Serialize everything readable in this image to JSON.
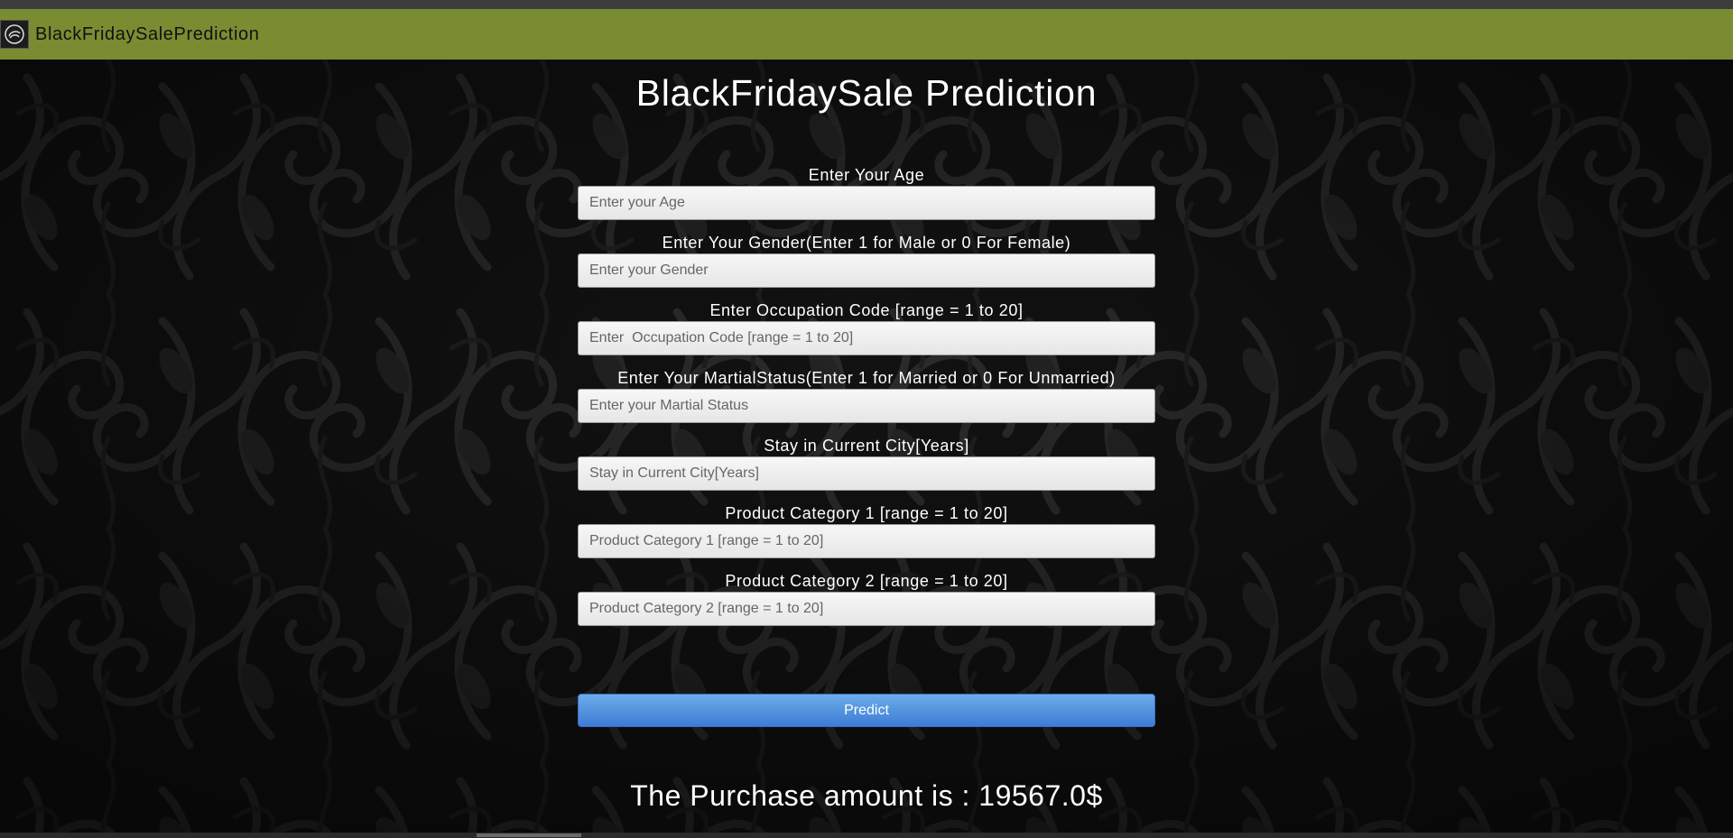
{
  "navbar": {
    "title": "BlackFridaySalePrediction",
    "logo_icon": "logo-icon"
  },
  "page": {
    "title": "BlackFridaySale Prediction"
  },
  "form": {
    "fields": [
      {
        "label": "Enter Your Age",
        "placeholder": "Enter your Age"
      },
      {
        "label": "Enter Your Gender(Enter 1 for Male or 0 For Female)",
        "placeholder": "Enter your Gender"
      },
      {
        "label": "Enter Occupation Code [range = 1 to 20]",
        "placeholder": "Enter  Occupation Code [range = 1 to 20]"
      },
      {
        "label": "Enter Your MartialStatus(Enter 1 for Married or 0 For Unmarried)",
        "placeholder": "Enter your Martial Status"
      },
      {
        "label": "Stay in Current City[Years]",
        "placeholder": "Stay in Current City[Years]"
      },
      {
        "label": "Product Category 1 [range = 1 to 20]",
        "placeholder": "Product Category 1 [range = 1 to 20]"
      },
      {
        "label": "Product Category 2 [range = 1 to 20]",
        "placeholder": "Product Category 2 [range = 1 to 20]"
      }
    ],
    "submit_label": "Predict"
  },
  "result": {
    "text": "The Purchase amount is : 19567.0$"
  },
  "colors": {
    "navbar": "#7a8c32",
    "button": "#4a8be0"
  }
}
